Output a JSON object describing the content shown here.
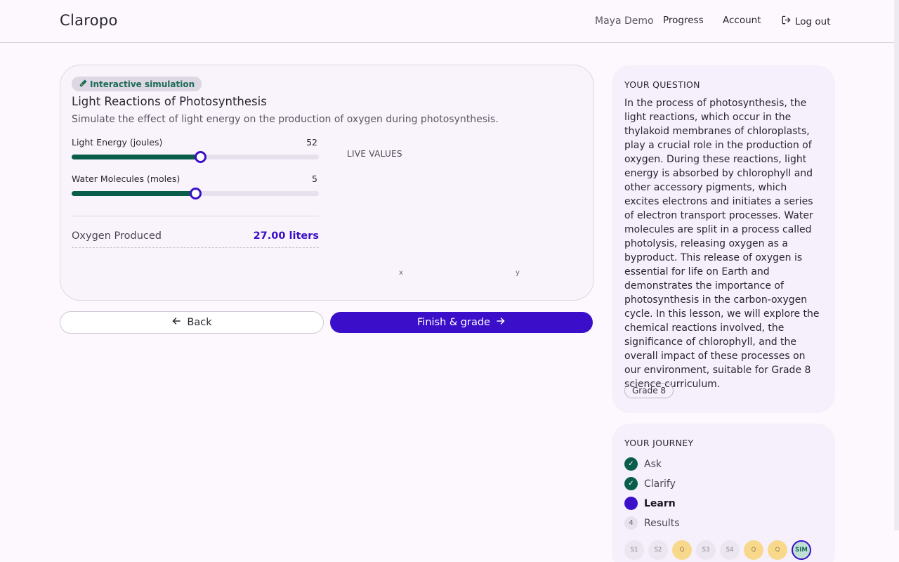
{
  "header": {
    "brand": "Claropo",
    "user_name": "Maya Demo",
    "progress_label": "Progress",
    "account_label": "Account",
    "logout_label": "Log out"
  },
  "simulation": {
    "badge_label": "Interactive simulation",
    "title": "Light Reactions of Photosynthesis",
    "description": "Simulate the effect of light energy on the production of oxygen during photosynthesis.",
    "sliders": [
      {
        "label": "Light Energy (joules)",
        "value": "52",
        "fill_fraction": 0.52
      },
      {
        "label": "Water Molecules (moles)",
        "value": "5",
        "fill_fraction": 0.5
      }
    ],
    "output": {
      "label": "Oxygen Produced",
      "value": "27.00 liters"
    },
    "live_values_title": "LIVE VALUES",
    "axis_x_label": "x",
    "axis_y_label": "y"
  },
  "actions": {
    "back_label": "Back",
    "finish_label": "Finish & grade"
  },
  "question": {
    "heading": "YOUR QUESTION",
    "text": "In the process of photosynthesis, the light reactions, which occur in the thylakoid membranes of chloroplasts, play a crucial role in the production of oxygen. During these reactions, light energy is absorbed by chlorophyll and other accessory pigments, which excites electrons and initiates a series of electron transport processes. Water molecules are split in a process called photolysis, releasing oxygen as a byproduct. This release of oxygen is essential for life on Earth and demonstrates the importance of photosynthesis in the carbon-oxygen cycle. In this lesson, we will explore the chemical reactions involved, the significance of chlorophyll, and the overall impact of these processes on our environment, suitable for Grade 8 science curriculum.",
    "grade_tag": "Grade 8"
  },
  "journey": {
    "heading": "YOUR JOURNEY",
    "steps": [
      {
        "label": "Ask",
        "state": "done",
        "marker": "✓"
      },
      {
        "label": "Clarify",
        "state": "done",
        "marker": "✓"
      },
      {
        "label": "Learn",
        "state": "current",
        "marker": ""
      },
      {
        "label": "Results",
        "state": "todo",
        "marker": "4"
      }
    ],
    "chips": [
      {
        "label": "S1",
        "kind": "step"
      },
      {
        "label": "S2",
        "kind": "step"
      },
      {
        "label": "Q",
        "kind": "quiz"
      },
      {
        "label": "S3",
        "kind": "step"
      },
      {
        "label": "S4",
        "kind": "step"
      },
      {
        "label": "Q",
        "kind": "quiz"
      },
      {
        "label": "Q",
        "kind": "quiz"
      },
      {
        "label": "SIM",
        "kind": "sim"
      }
    ]
  },
  "colors": {
    "accent": "#3b0fca",
    "success": "#0b5d4b",
    "background": "#fcf8fe"
  }
}
